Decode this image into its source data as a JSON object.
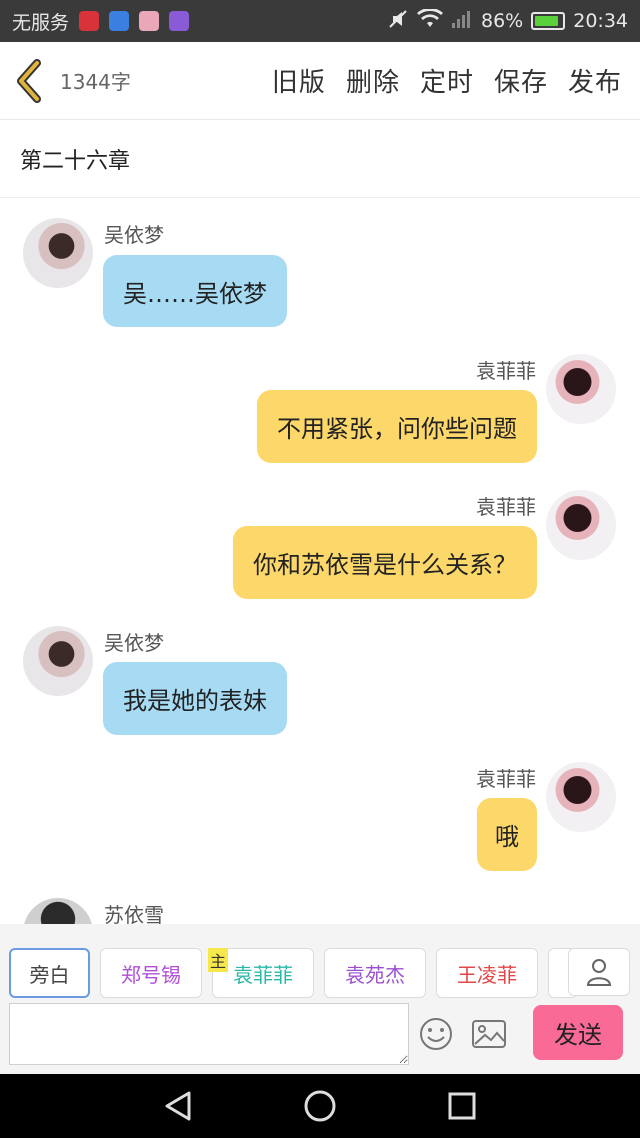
{
  "status_bar": {
    "carrier": "无服务",
    "battery": "86%",
    "time": "20:34"
  },
  "header": {
    "word_count": "1344字",
    "actions": [
      "旧版",
      "删除",
      "定时",
      "保存",
      "发布"
    ]
  },
  "chapter_title": "第二十六章",
  "messages": [
    {
      "side": "left",
      "name": "吴依梦",
      "text": "吴……吴依梦"
    },
    {
      "side": "right",
      "name": "袁菲菲",
      "text": "不用紧张，问你些问题"
    },
    {
      "side": "right",
      "name": "袁菲菲",
      "text": "你和苏依雪是什么关系？"
    },
    {
      "side": "left",
      "name": "吴依梦",
      "text": "我是她的表妹"
    },
    {
      "side": "right",
      "name": "袁菲菲",
      "text": "哦"
    },
    {
      "side": "left",
      "name": "苏依雪",
      "text": ""
    }
  ],
  "roles": {
    "items": [
      {
        "label": "旁白",
        "color": "#444444"
      },
      {
        "label": "郑号锡",
        "color": "#b04fd6"
      },
      {
        "label": "袁菲菲",
        "color": "#2ab8a8"
      },
      {
        "label": "袁苑杰",
        "color": "#9b4fd0"
      },
      {
        "label": "王凌菲",
        "color": "#e24747"
      }
    ],
    "main_tag": "主"
  },
  "input": {
    "placeholder": "",
    "send_label": "发送"
  },
  "colors": {
    "bubble_left": "#a7dbf4",
    "bubble_right": "#fcd76a",
    "send_button": "#f96a96",
    "accent_back": "#e0b43a"
  }
}
